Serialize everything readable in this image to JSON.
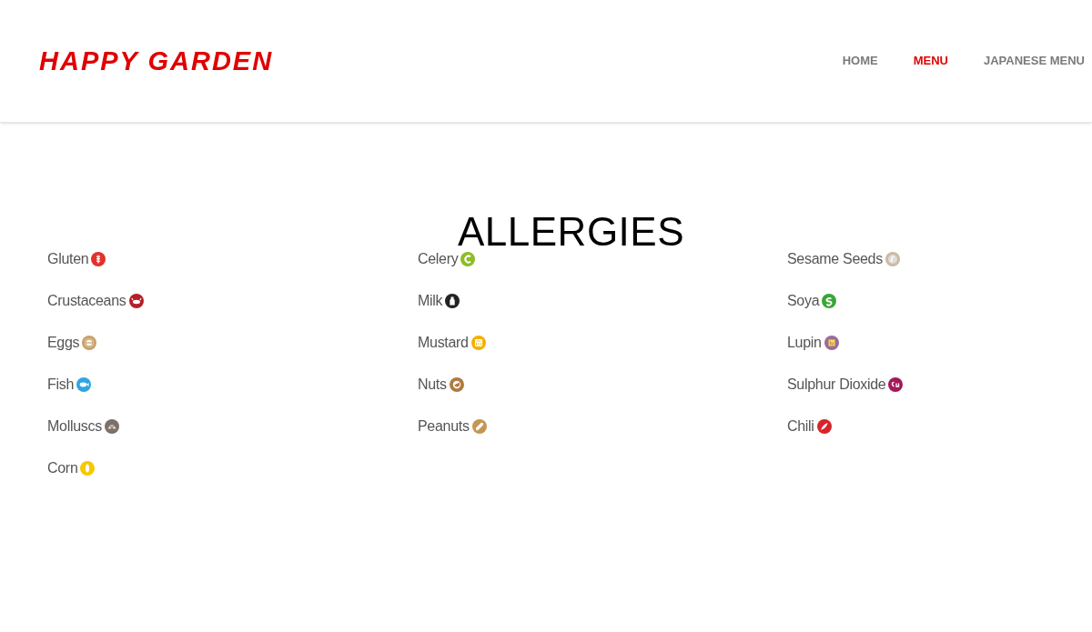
{
  "logo": "HAPPY GARDEN",
  "nav": [
    {
      "label": "HOME",
      "selected": false
    },
    {
      "label": "MENU",
      "selected": true
    },
    {
      "label": "JAPANESE MENU",
      "selected": false
    }
  ],
  "title": "ALLERGIES",
  "columns": [
    [
      {
        "label": "Gluten",
        "color": "#e2312b"
      },
      {
        "label": "Crustaceans",
        "color": "#b51f2a"
      },
      {
        "label": "Eggs",
        "color": "#c9a06a"
      },
      {
        "label": "Fish",
        "color": "#2fa6e0"
      },
      {
        "label": "Molluscs",
        "color": "#7d7068"
      },
      {
        "label": "Corn",
        "color": "#f5c800"
      }
    ],
    [
      {
        "label": "Celery",
        "color": "#8cbd2b"
      },
      {
        "label": "Milk",
        "color": "#222222"
      },
      {
        "label": "Mustard",
        "color": "#f2b100"
      },
      {
        "label": "Nuts",
        "color": "#b07b3e"
      },
      {
        "label": "Peanuts",
        "color": "#c49654"
      }
    ],
    [
      {
        "label": "Sesame Seeds",
        "color": "#cbbba0"
      },
      {
        "label": "Soya",
        "color": "#3aa636"
      },
      {
        "label": "Lupin",
        "color": "#9c6b9b"
      },
      {
        "label": "Sulphur Dioxide",
        "color": "#a3195b"
      },
      {
        "label": "Chili",
        "color": "#d9232b"
      }
    ]
  ]
}
